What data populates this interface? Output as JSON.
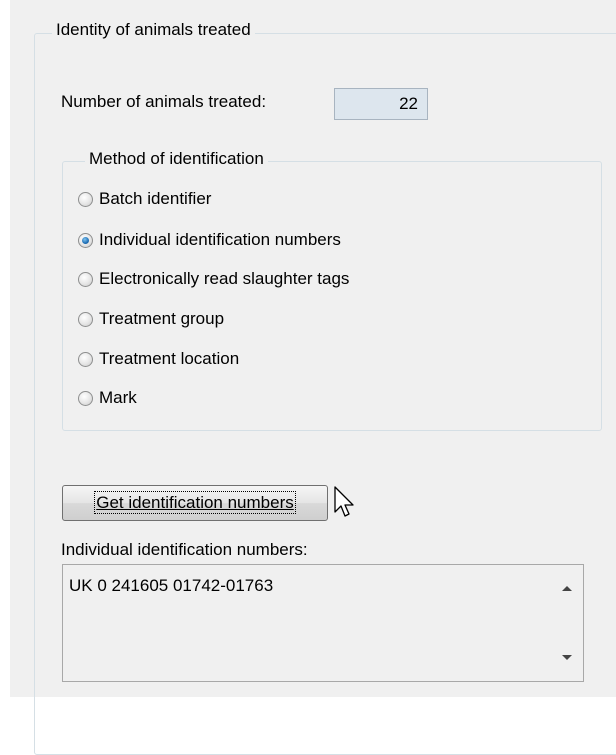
{
  "identity_group": {
    "title": "Identity of animals treated",
    "count_label": "Number of animals treated:",
    "count_value": "22",
    "method_group": {
      "title": "Method of identification",
      "options": [
        {
          "label": "Batch identifier",
          "checked": false
        },
        {
          "label": "Individual identification numbers",
          "checked": true
        },
        {
          "label": "Electronically read slaughter tags",
          "checked": false
        },
        {
          "label": "Treatment group",
          "checked": false
        },
        {
          "label": "Treatment location",
          "checked": false
        },
        {
          "label": "Mark",
          "checked": false
        }
      ]
    },
    "get_button_label": "Get identification numbers",
    "ids_label": "Individual identification numbers:",
    "ids_value": "UK 0 241605 01742-01763"
  }
}
